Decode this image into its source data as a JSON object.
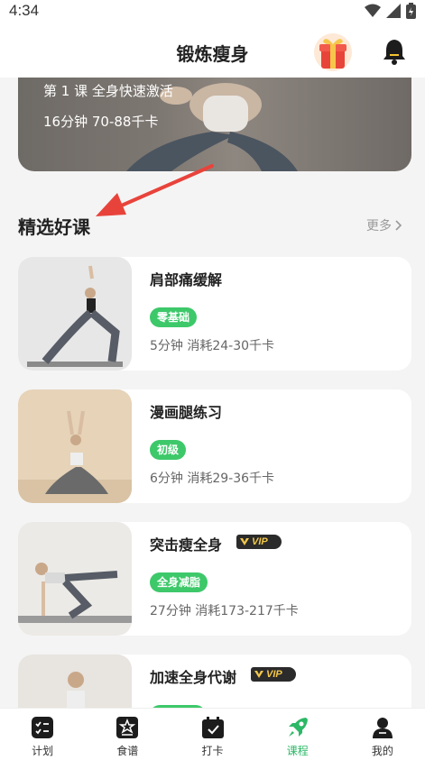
{
  "status": {
    "time": "4:34"
  },
  "header": {
    "title": "锻炼瘦身"
  },
  "hero": {
    "line1": "第 1 课 全身快速激活",
    "line2": "16分钟 70-88千卡"
  },
  "section": {
    "title": "精选好课",
    "more": "更多"
  },
  "courses": [
    {
      "title": "肩部痛缓解",
      "badge": "零基础",
      "meta": "5分钟 消耗24-30千卡",
      "vip": false
    },
    {
      "title": "漫画腿练习",
      "badge": "初级",
      "meta": "6分钟 消耗29-36千卡",
      "vip": false
    },
    {
      "title": "突击瘦全身",
      "badge": "全身减脂",
      "meta": "27分钟 消耗173-217千卡",
      "vip": true,
      "vip_label": "VIP"
    },
    {
      "title": "加速全身代谢",
      "badge": "",
      "meta": "",
      "vip": true,
      "vip_label": "VIP"
    }
  ],
  "tabs": [
    {
      "label": "计划",
      "icon": "plan-icon",
      "active": false
    },
    {
      "label": "食谱",
      "icon": "recipe-icon",
      "active": false
    },
    {
      "label": "打卡",
      "icon": "checkin-icon",
      "active": false
    },
    {
      "label": "课程",
      "icon": "rocket-icon",
      "active": true
    },
    {
      "label": "我的",
      "icon": "profile-icon",
      "active": false
    }
  ],
  "colors": {
    "accent": "#2cb866",
    "badge": "#3dc86a",
    "arrow": "#e8433b",
    "vip_gold": "#f3c84b"
  }
}
